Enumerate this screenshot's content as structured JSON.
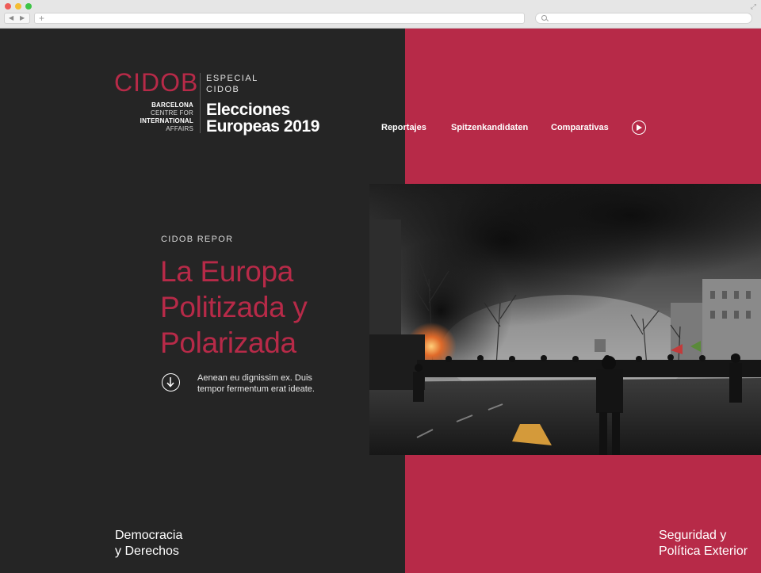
{
  "browser": {
    "back_icon": "◀",
    "forward_icon": "▶",
    "new_tab_icon": "+"
  },
  "brand": {
    "logo": "CIDOB",
    "sub": [
      "BARCELONA",
      "CENTRE FOR",
      "INTERNATIONAL",
      "AFFAIRS"
    ],
    "especial": [
      "ESPECIAL",
      "CIDOB"
    ],
    "title": [
      "Elecciones",
      "Europeas 2019"
    ]
  },
  "nav": {
    "items": [
      "Reportajes",
      "Spitzenkandidaten",
      "Comparativas"
    ]
  },
  "hero": {
    "kicker": "CIDOB REPOR",
    "headline": [
      "La Europa",
      "Politizada y",
      "Polarizada"
    ],
    "dek": [
      "Aenean eu dignissim ex. Duis",
      "tempor fermentum erat ideate."
    ]
  },
  "categories": {
    "left": [
      "Democracia",
      "y Derechos"
    ],
    "right": [
      "Seguridad y",
      "Política Exterior"
    ]
  },
  "colors": {
    "accent": "#b72a48",
    "dark_bg": "#252525",
    "text_light": "#ffffff"
  },
  "icons": {
    "play": "play-circle-icon",
    "scroll": "arrow-down-circle-icon",
    "search": "search-icon"
  }
}
